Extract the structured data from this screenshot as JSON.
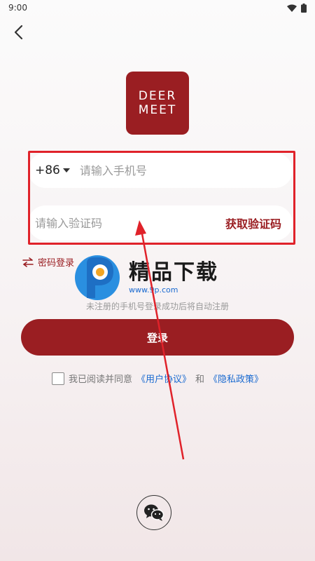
{
  "status_bar": {
    "time": "9:00"
  },
  "logo": {
    "line1": "DEER",
    "line2": "MEET"
  },
  "phone_field": {
    "country_code": "+86",
    "placeholder": "请输入手机号"
  },
  "code_field": {
    "placeholder": "请输入验证码",
    "get_code_label": "获取验证码"
  },
  "password_login_label": "密码登录",
  "watermark": {
    "title": "精品下载",
    "url": "www.9p.com"
  },
  "hint_text": "未注册的手机号登录成功后将自动注册",
  "login_button_label": "登录",
  "agreement": {
    "prefix": "我已阅读并同意",
    "user_agreement": "《用户协议》",
    "and": "和",
    "privacy_policy": "《隐私政策》"
  },
  "colors": {
    "brand": "#9a1e22",
    "link": "#1a6ad0",
    "annotation": "#e0222a"
  }
}
